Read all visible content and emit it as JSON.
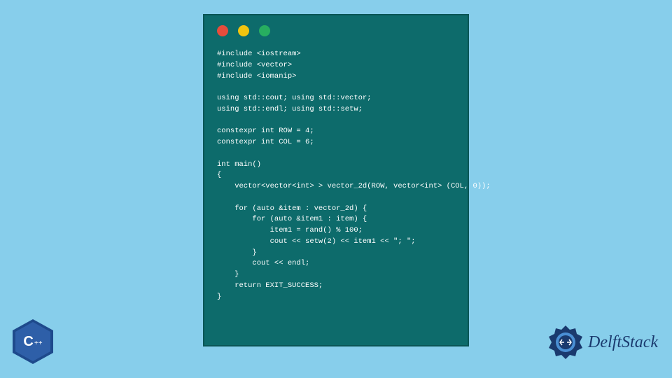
{
  "code": {
    "lines": "#include <iostream>\n#include <vector>\n#include <iomanip>\n\nusing std::cout; using std::vector;\nusing std::endl; using std::setw;\n\nconstexpr int ROW = 4;\nconstexpr int COL = 6;\n\nint main()\n{\n    vector<vector<int> > vector_2d(ROW, vector<int> (COL, 0));\n\n    for (auto &item : vector_2d) {\n        for (auto &item1 : item) {\n            item1 = rand() % 100;\n            cout << setw(2) << item1 << \"; \";\n        }\n        cout << endl;\n    }\n    return EXIT_SUCCESS;\n}"
  },
  "cpp_badge": {
    "letter": "C",
    "plus": "++"
  },
  "brand": {
    "name": "DelftStack"
  },
  "colors": {
    "background": "#87ceeb",
    "code_window": "#0d6b6b",
    "brand_color": "#1a3a6e"
  }
}
